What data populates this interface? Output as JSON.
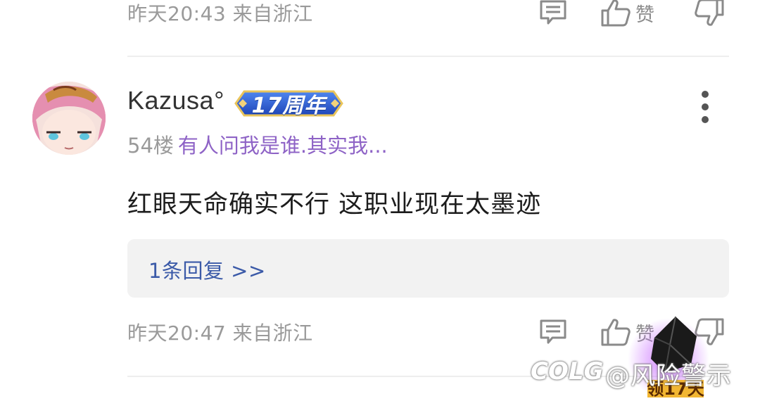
{
  "prev_comment": {
    "time_location": "昨天20:43 来自浙江",
    "like_label": "赞"
  },
  "comment": {
    "username": "Kazusa°",
    "badge": "17周年",
    "floor": "54楼",
    "user_title": "有人问我是谁.其实我...",
    "content": "红眼天命确实不行 这职业现在太墨迹",
    "reply_link": "1条回复 >>",
    "time_location": "昨天20:47 来自浙江",
    "like_label": "赞"
  },
  "watermark": {
    "logo": "COLG",
    "text": "@风险警示",
    "promo": "领17天"
  },
  "colors": {
    "title_purple": "#8e63c6",
    "reply_blue": "#3b5aa8",
    "meta_gray": "#9a9a9a",
    "badge_blue": "#2e5fd4"
  },
  "icons": [
    "comment-icon",
    "thumbs-up-icon",
    "thumbs-down-icon",
    "more-vertical-icon"
  ]
}
